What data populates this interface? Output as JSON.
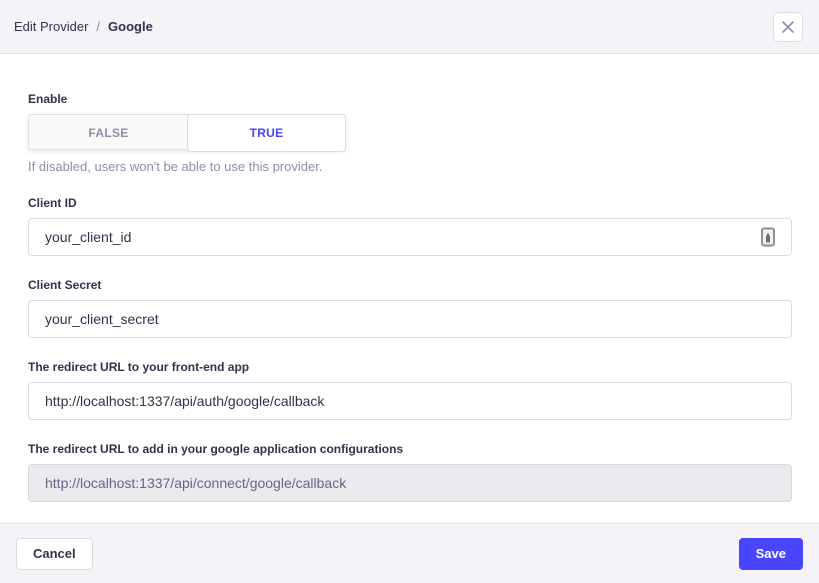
{
  "header": {
    "breadcrumb": {
      "section": "Edit Provider",
      "separator": "/",
      "current": "Google"
    },
    "close_icon": "x-icon"
  },
  "form": {
    "enable": {
      "label": "Enable",
      "options": [
        {
          "label": "FALSE",
          "selected": false
        },
        {
          "label": "TRUE",
          "selected": true
        }
      ],
      "helper": "If disabled, users won't be able to use this provider."
    },
    "client_id": {
      "label": "Client ID",
      "value": "your_client_id",
      "trailing_icon": "password-manager-icon"
    },
    "client_secret": {
      "label": "Client Secret",
      "value": "your_client_secret"
    },
    "redirect_front_end": {
      "label": "The redirect URL to your front-end app",
      "value": "http://localhost:1337/api/auth/google/callback"
    },
    "redirect_google_config": {
      "label": "The redirect URL to add in your google application configurations",
      "value": "http://localhost:1337/api/connect/google/callback",
      "disabled": true
    }
  },
  "footer": {
    "cancel_label": "Cancel",
    "save_label": "Save"
  },
  "colors": {
    "accent": "#4945ff",
    "panel_bg": "#f4f4f8",
    "border": "#dcdce4",
    "text": "#32324d",
    "muted_text": "#8e8ea9",
    "disabled_input_bg": "#eaeaef"
  }
}
